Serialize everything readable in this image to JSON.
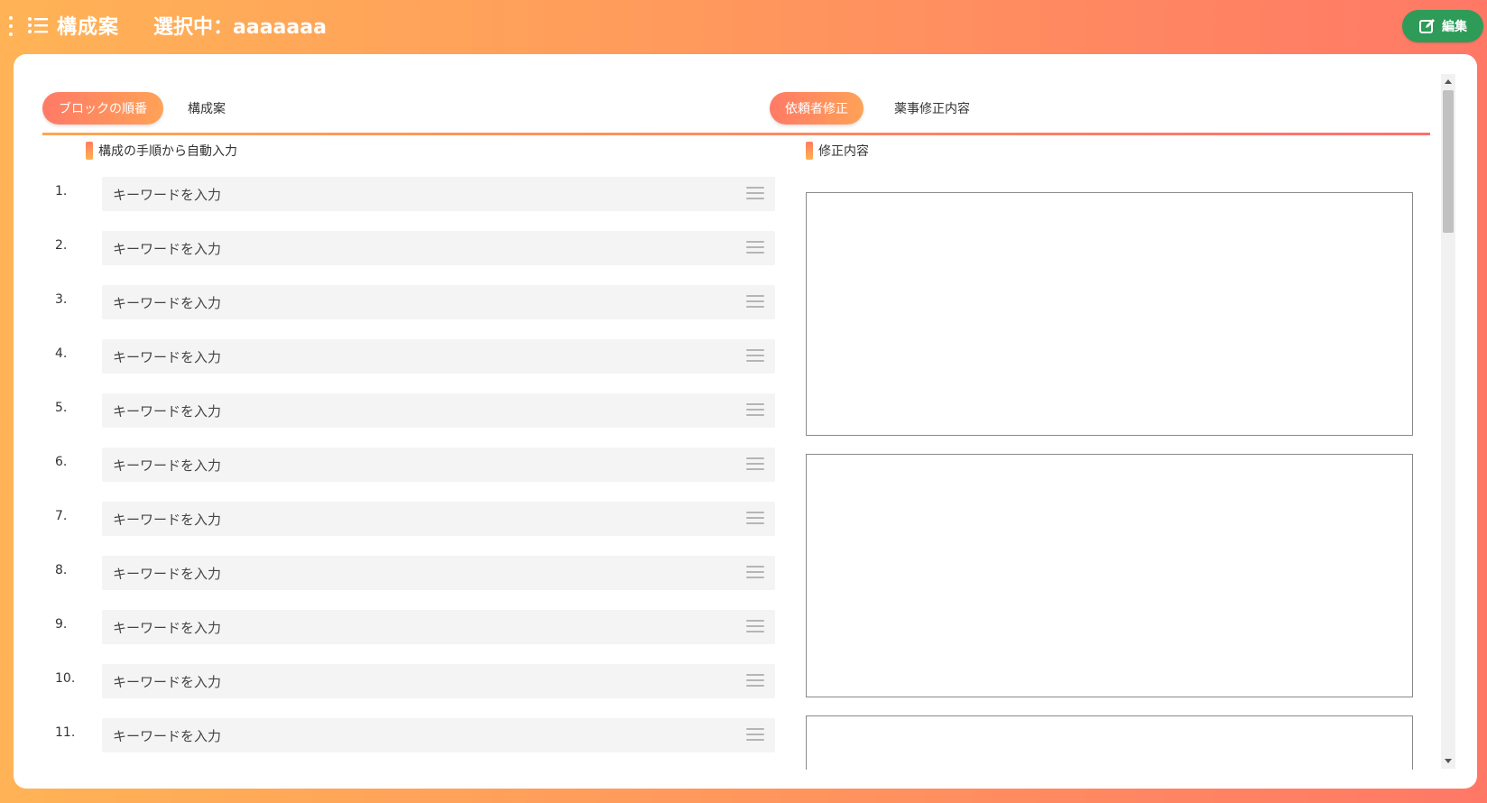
{
  "header": {
    "title": "構成案",
    "selected_label": "選択中：aaaaaaa",
    "edit_label": "編集"
  },
  "left_tabs": [
    {
      "label": "ブロックの順番",
      "active": true
    },
    {
      "label": "構成案",
      "active": false
    }
  ],
  "right_tabs": [
    {
      "label": "依頼者修正",
      "active": true
    },
    {
      "label": "薬事修正内容",
      "active": false
    }
  ],
  "left_section": {
    "heading": "構成の手順から自動入力",
    "rows": [
      {
        "num": "1.",
        "placeholder": "キーワードを入力"
      },
      {
        "num": "2.",
        "placeholder": "キーワードを入力"
      },
      {
        "num": "3.",
        "placeholder": "キーワードを入力"
      },
      {
        "num": "4.",
        "placeholder": "キーワードを入力"
      },
      {
        "num": "5.",
        "placeholder": "キーワードを入力"
      },
      {
        "num": "6.",
        "placeholder": "キーワードを入力"
      },
      {
        "num": "7.",
        "placeholder": "キーワードを入力"
      },
      {
        "num": "8.",
        "placeholder": "キーワードを入力"
      },
      {
        "num": "9.",
        "placeholder": "キーワードを入力"
      },
      {
        "num": "10.",
        "placeholder": "キーワードを入力"
      },
      {
        "num": "11.",
        "placeholder": "キーワードを入力"
      }
    ]
  },
  "right_section": {
    "heading": "修正内容"
  },
  "colors": {
    "accent_start": "#ffb356",
    "accent_end": "#ff7866",
    "edit_button": "#2e9b58"
  }
}
